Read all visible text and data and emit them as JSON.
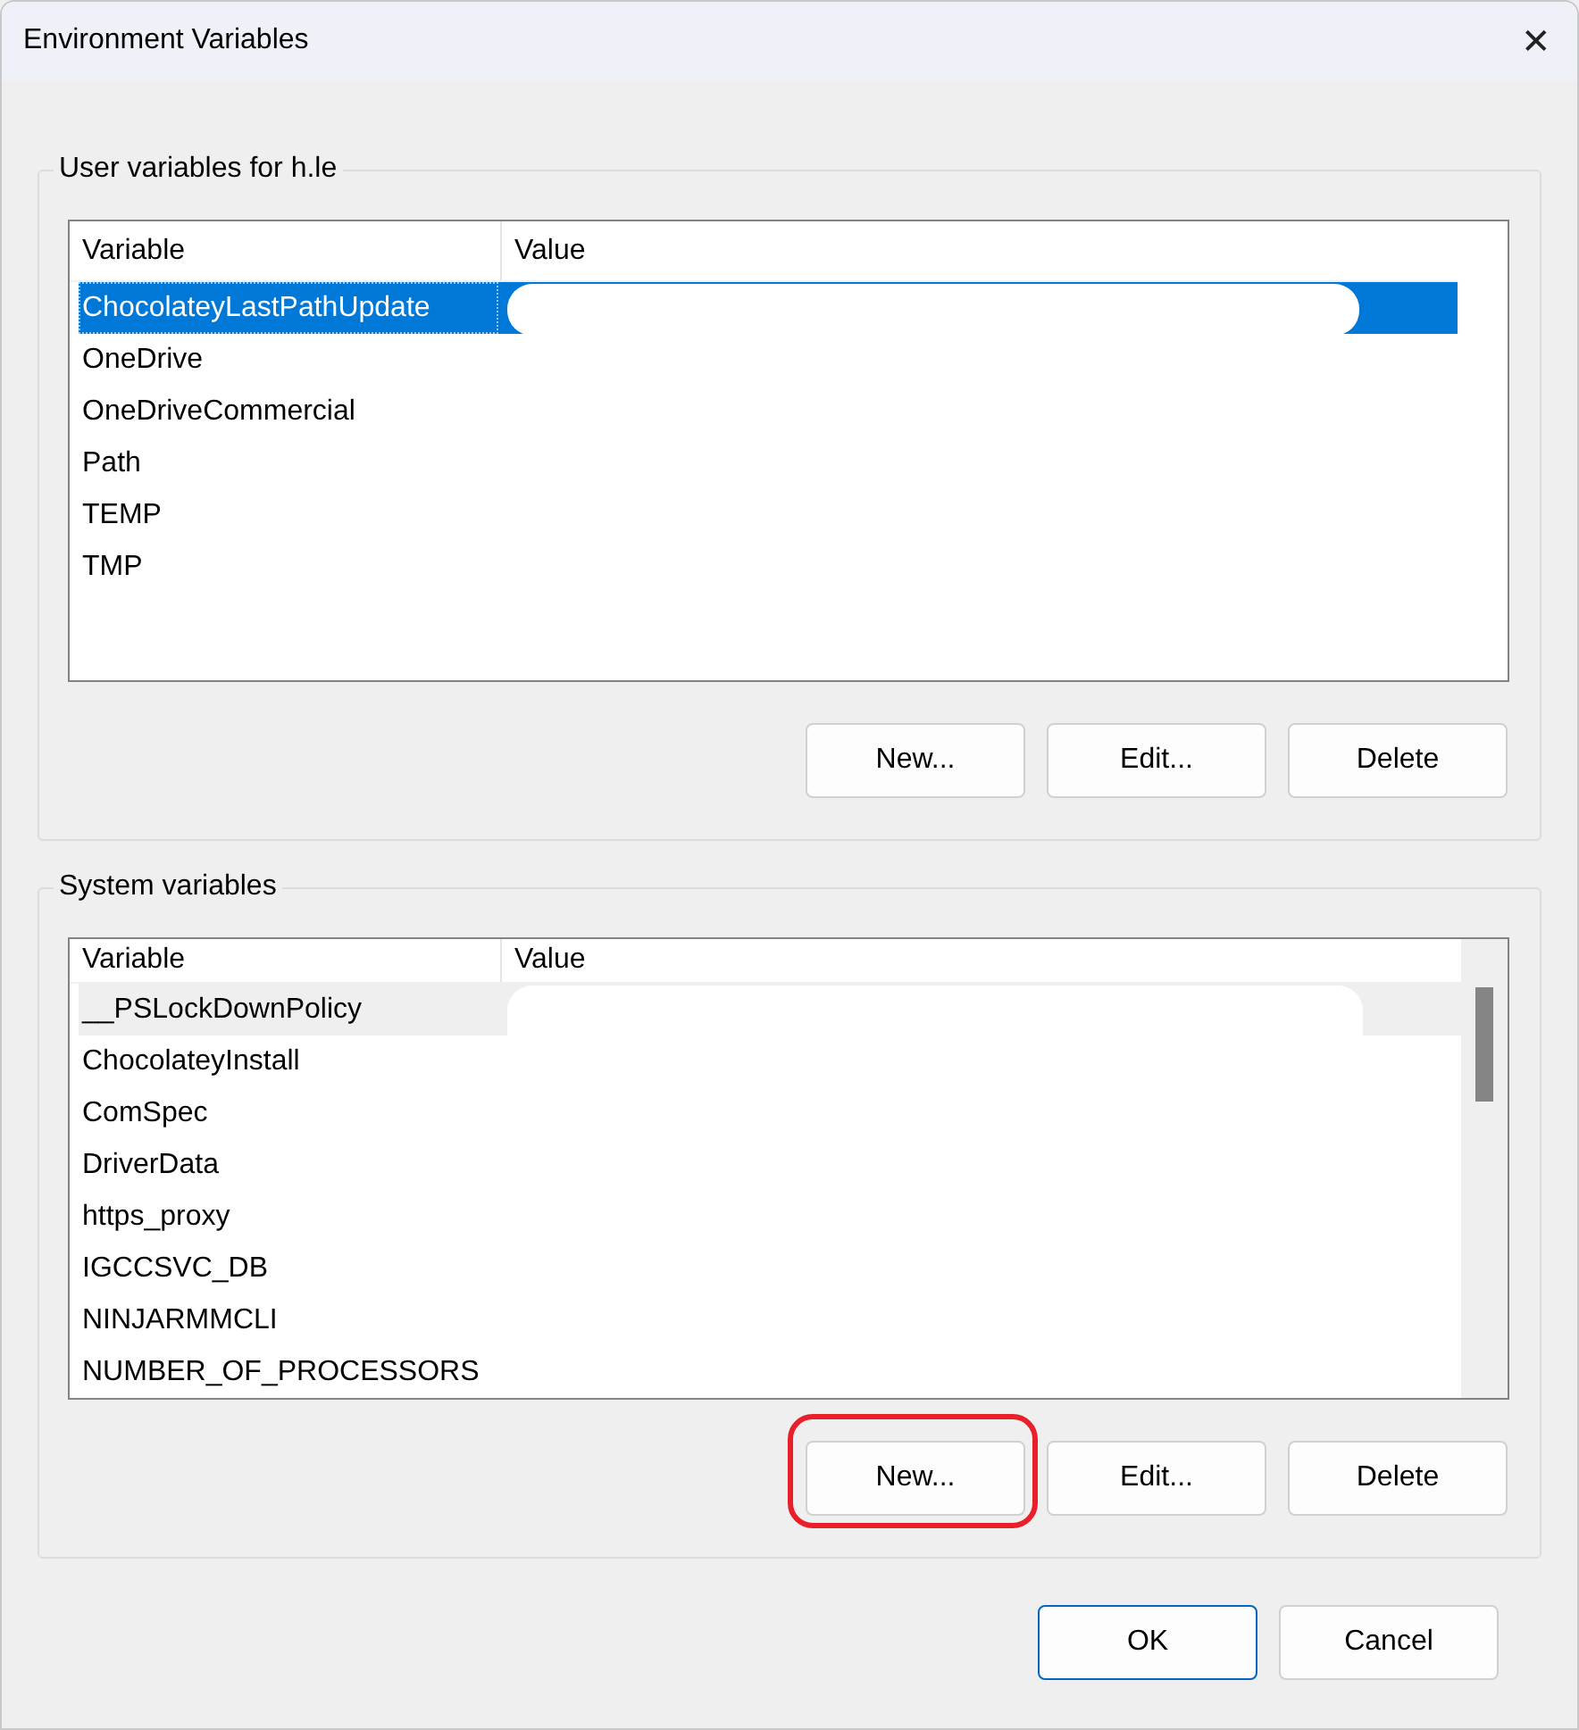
{
  "window": {
    "title": "Environment Variables",
    "close": "✕"
  },
  "groups": [
    {
      "title": "User variables for h.le",
      "focused": true,
      "scrollbar": false,
      "columns": [
        "Variable",
        "Value"
      ],
      "rows": [
        {
          "name": "ChocolateyLastPathUpdate",
          "selected": true,
          "redacted": true
        },
        {
          "name": "OneDrive",
          "selected": false
        },
        {
          "name": "OneDriveCommercial",
          "selected": false
        },
        {
          "name": "Path",
          "selected": false
        },
        {
          "name": "TEMP",
          "selected": false
        },
        {
          "name": "TMP",
          "selected": false
        }
      ],
      "buttons": [
        {
          "label": "New..."
        },
        {
          "label": "Edit..."
        },
        {
          "label": "Delete"
        }
      ]
    },
    {
      "title": "System variables",
      "focused": false,
      "scrollbar": true,
      "columns": [
        "Variable",
        "Value"
      ],
      "rows": [
        {
          "name": "__PSLockDownPolicy",
          "selected": true,
          "redacted": true
        },
        {
          "name": "ChocolateyInstall",
          "selected": false
        },
        {
          "name": "ComSpec",
          "selected": false
        },
        {
          "name": "DriverData",
          "selected": false
        },
        {
          "name": "https_proxy",
          "selected": false
        },
        {
          "name": "IGCCSVC_DB",
          "selected": false
        },
        {
          "name": "NINJARMMCLI",
          "selected": false
        },
        {
          "name": "NUMBER_OF_PROCESSORS",
          "selected": false
        }
      ],
      "buttons": [
        {
          "label": "New...",
          "highlighted": true
        },
        {
          "label": "Edit..."
        },
        {
          "label": "Delete"
        }
      ]
    }
  ],
  "footer": [
    {
      "label": "OK",
      "default": true
    },
    {
      "label": "Cancel",
      "default": false
    }
  ]
}
